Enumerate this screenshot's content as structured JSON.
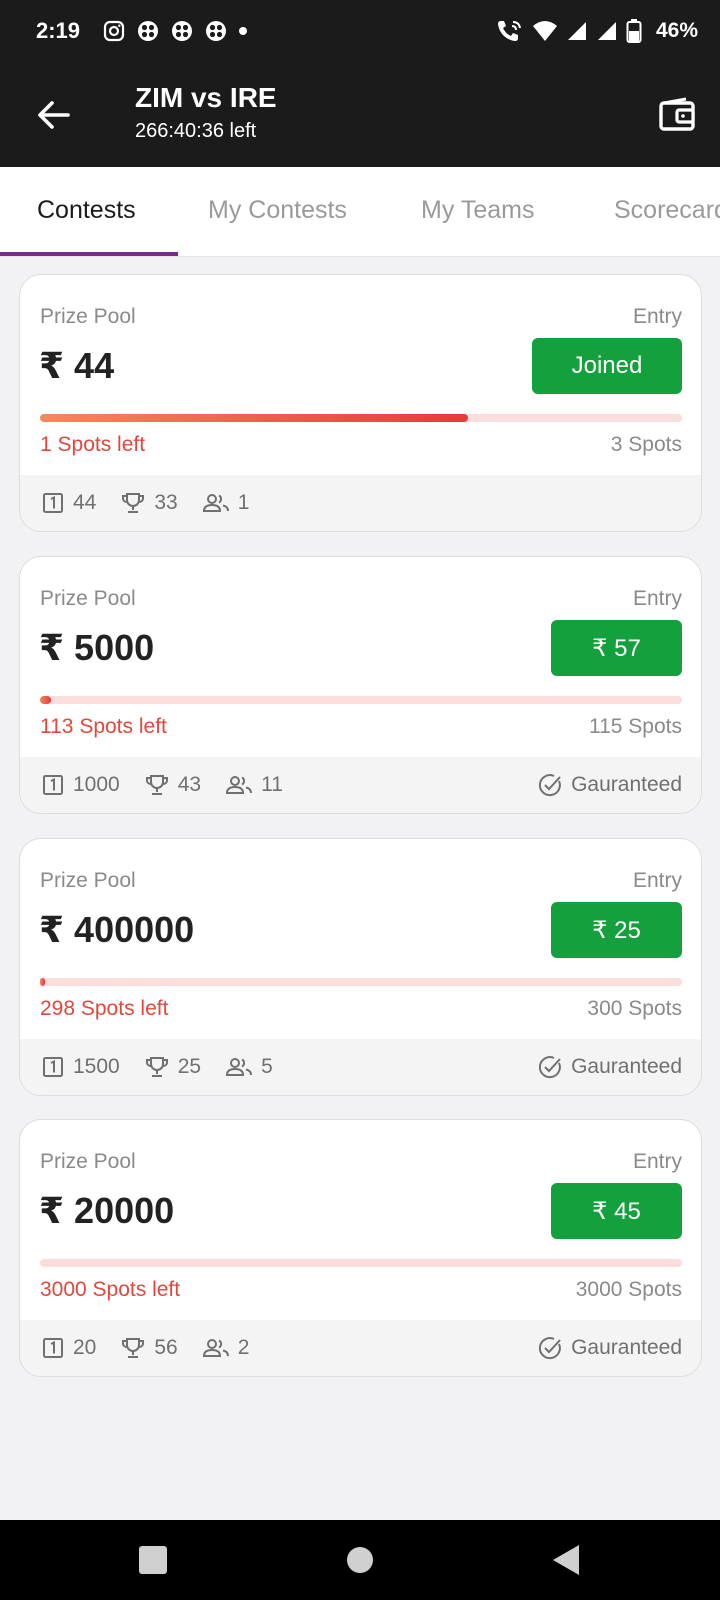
{
  "status_bar": {
    "time": "2:19",
    "battery": "46%"
  },
  "header": {
    "title": "ZIM vs IRE",
    "countdown": "266:40:36 left"
  },
  "tabs": [
    {
      "label": "Contests",
      "active": true
    },
    {
      "label": "My Contests",
      "active": false
    },
    {
      "label": "My Teams",
      "active": false
    },
    {
      "label": "Scorecard",
      "active": false
    }
  ],
  "contests": [
    {
      "prize_label": "Prize Pool",
      "entry_label": "Entry",
      "prize": "₹ 44",
      "entry": "Joined",
      "fill_fraction": 0.667,
      "spots_left": "1 Spots left",
      "spots_total": "3 Spots",
      "first_prize": "44",
      "winners": "33",
      "team_limit": "1",
      "guaranteed": ""
    },
    {
      "prize_label": "Prize Pool",
      "entry_label": "Entry",
      "prize": "₹ 5000",
      "entry": "₹ 57",
      "fill_fraction": 0.017,
      "spots_left": "113 Spots left",
      "spots_total": "115 Spots",
      "first_prize": "1000",
      "winners": "43",
      "team_limit": "11",
      "guaranteed": "Gauranteed"
    },
    {
      "prize_label": "Prize Pool",
      "entry_label": "Entry",
      "prize": "₹ 400000",
      "entry": "₹ 25",
      "fill_fraction": 0.007,
      "spots_left": "298 Spots left",
      "spots_total": "300 Spots",
      "first_prize": "1500",
      "winners": "25",
      "team_limit": "5",
      "guaranteed": "Gauranteed"
    },
    {
      "prize_label": "Prize Pool",
      "entry_label": "Entry",
      "prize": "₹ 20000",
      "entry": "₹ 45",
      "fill_fraction": 0,
      "spots_left": "3000 Spots left",
      "spots_total": "3000 Spots",
      "first_prize": "20",
      "winners": "56",
      "team_limit": "2",
      "guaranteed": "Gauranteed"
    }
  ],
  "colors": {
    "accent": "#7a2a8e",
    "entry_button": "#14a03c",
    "spots_left": "#e0483d",
    "appbar": "#1b1b1b"
  }
}
